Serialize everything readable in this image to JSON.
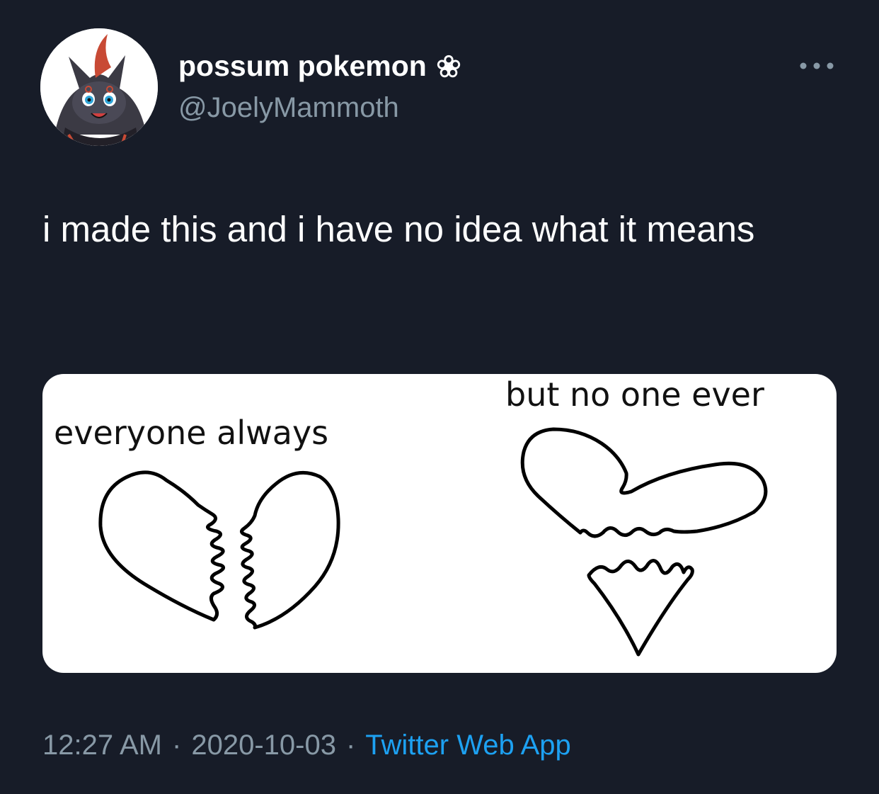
{
  "tweet": {
    "display_name": "possum pokemon",
    "handle": "@JoelyMammoth",
    "text": "i made this and i have no idea what it means",
    "media": {
      "caption_left": "everyone always",
      "caption_right": "but no one ever"
    },
    "time": "12:27 AM",
    "date": "2020-10-03",
    "separator": "·",
    "source": "Twitter Web App"
  },
  "colors": {
    "background": "#171c28",
    "text": "#ffffff",
    "secondary_text": "#8899a6",
    "link": "#1da1f2"
  },
  "icons": {
    "avatar": "pokemon-avatar",
    "name_badge": "flower-icon",
    "more": "more-dots-icon"
  }
}
